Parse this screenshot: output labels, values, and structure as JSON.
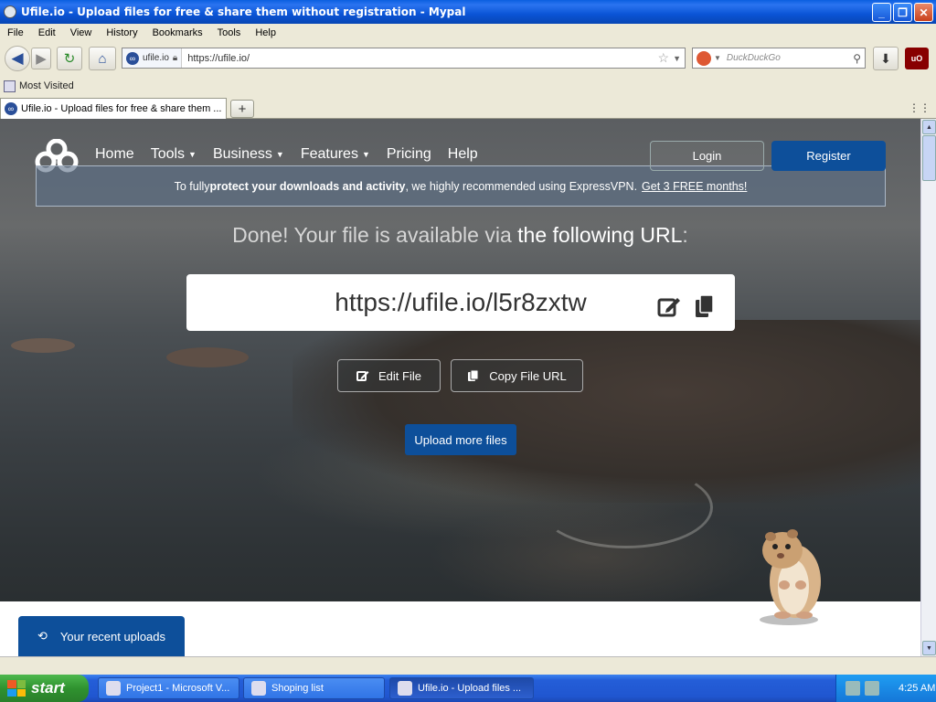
{
  "window": {
    "title": "Ufile.io - Upload files for free & share them without registration - Mypal",
    "minimize": "_",
    "restore": "❐",
    "close": "✕"
  },
  "menu": [
    "File",
    "Edit",
    "View",
    "History",
    "Bookmarks",
    "Tools",
    "Help"
  ],
  "navbar": {
    "site_identity": "ufile.io",
    "url": "https://ufile.io/",
    "search_placeholder": "DuckDuckGo"
  },
  "bookmarks": {
    "most_visited": "Most Visited"
  },
  "tabs": {
    "active_label": "Ufile.io - Upload files for free & share them ...",
    "new_tab": "+"
  },
  "site": {
    "nav": {
      "home": "Home",
      "tools": "Tools",
      "business": "Business",
      "features": "Features",
      "pricing": "Pricing",
      "help": "Help"
    },
    "login": "Login",
    "register": "Register",
    "banner": {
      "prefix": "To fully ",
      "strong": "protect your downloads and activity",
      "middle": ", we highly recommended using ExpressVPN.",
      "link": "Get 3 FREE months!"
    },
    "done_prefix": "Done! Your file is available via ",
    "done_emphasis": "the following URL",
    "done_suffix": ":",
    "file_url": "https://ufile.io/l5r8zxtw",
    "edit_file": "Edit File",
    "copy_file_url": "Copy File URL",
    "upload_more": "Upload more files",
    "recent_uploads": "Your recent uploads"
  },
  "taskbar": {
    "start": "start",
    "items": [
      "Project1 - Microsoft V...",
      "Shoping list",
      "Ufile.io - Upload files ..."
    ],
    "clock": "4:25 AM"
  },
  "colors": {
    "brand_blue": "#0d4f9a",
    "xp_title_blue": "#0a54d6",
    "xp_start_green": "#2f922f"
  }
}
